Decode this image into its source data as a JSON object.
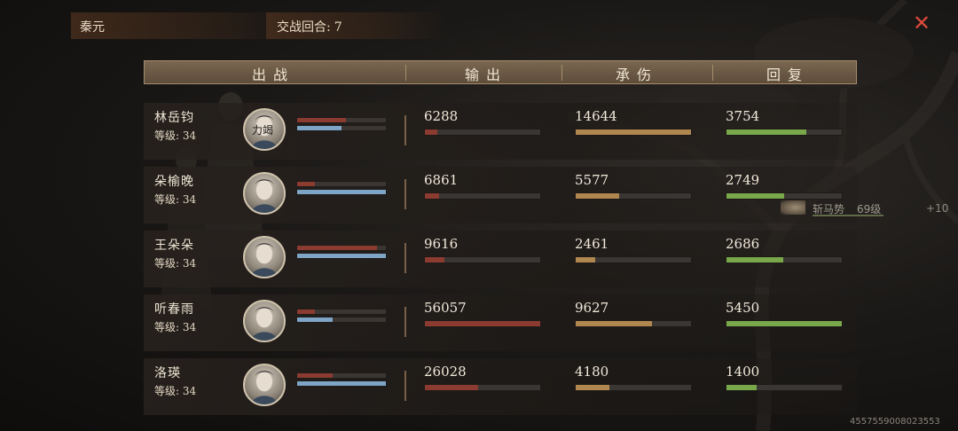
{
  "header": {
    "realm": "秦元",
    "rounds_label": "交战回合:",
    "rounds_value": "7",
    "close_icon": "close-icon"
  },
  "columns": {
    "fighter": "出战",
    "output": "输出",
    "damage_taken": "承伤",
    "healing": "回复"
  },
  "rows": [
    {
      "name": "林岳钧",
      "level_label": "等级:",
      "level": "34",
      "avatar_text": "力竭",
      "hp": 0.55,
      "mp": 0.5,
      "output": "6288",
      "output_pct": 0.11,
      "damage": "14644",
      "damage_pct": 1.0,
      "heal": "3754",
      "heal_pct": 0.69
    },
    {
      "name": "朵榆晚",
      "level_label": "等级:",
      "level": "34",
      "avatar_text": "",
      "hp": 0.2,
      "mp": 1.0,
      "output": "6861",
      "output_pct": 0.12,
      "damage": "5577",
      "damage_pct": 0.38,
      "heal": "2749",
      "heal_pct": 0.5
    },
    {
      "name": "王朵朵",
      "level_label": "等级:",
      "level": "34",
      "avatar_text": "",
      "hp": 0.9,
      "mp": 1.0,
      "output": "9616",
      "output_pct": 0.17,
      "damage": "2461",
      "damage_pct": 0.17,
      "heal": "2686",
      "heal_pct": 0.49
    },
    {
      "name": "听春雨",
      "level_label": "等级:",
      "level": "34",
      "avatar_text": "",
      "hp": 0.2,
      "mp": 0.4,
      "output": "56057",
      "output_pct": 1.0,
      "damage": "9627",
      "damage_pct": 0.66,
      "heal": "5450",
      "heal_pct": 1.0
    },
    {
      "name": "洛瑛",
      "level_label": "等级:",
      "level": "34",
      "avatar_text": "",
      "hp": 0.4,
      "mp": 1.0,
      "output": "26028",
      "output_pct": 0.46,
      "damage": "4180",
      "damage_pct": 0.29,
      "heal": "1400",
      "heal_pct": 0.26
    }
  ],
  "enemy": {
    "name": "斩马势",
    "level": "69级",
    "plus": "+10"
  },
  "uid": "4557559008023553",
  "colors": {
    "output": "#8c3b31",
    "damage": "#b0884f",
    "heal": "#79a84a",
    "mp": "#7ea4c6",
    "close": "#d9493c"
  }
}
